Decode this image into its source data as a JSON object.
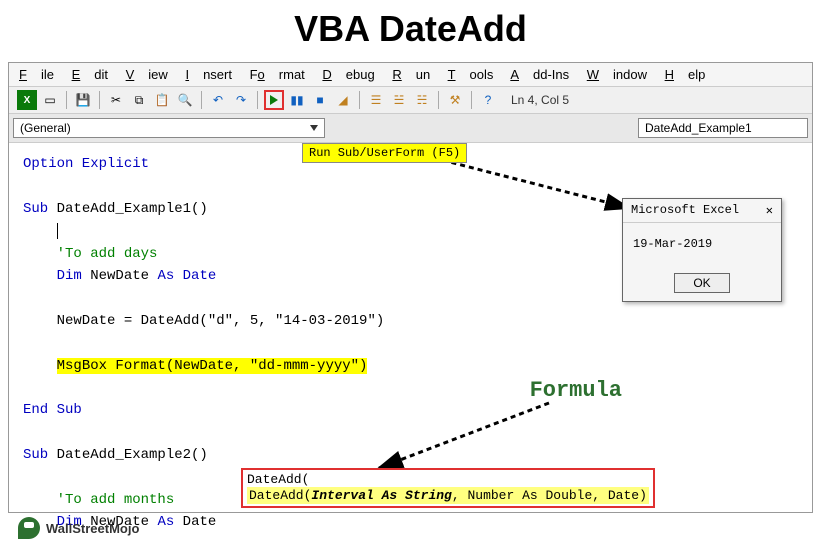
{
  "title": "VBA DateAdd",
  "menubar": [
    "File",
    "Edit",
    "View",
    "Insert",
    "Format",
    "Debug",
    "Run",
    "Tools",
    "Add-Ins",
    "Window",
    "Help"
  ],
  "status": "Ln 4, Col 5",
  "dropdowns": {
    "left": "(General)",
    "right": "DateAdd_Example1"
  },
  "callout_run": "Run Sub/UserForm (F5)",
  "code": {
    "l1": "Option Explicit",
    "l2": "Sub DateAdd_Example1()",
    "l3": "    'To add days",
    "l4": "    Dim NewDate As Date",
    "l5": "    NewDate = DateAdd(\"d\", 5, \"14-03-2019\")",
    "l6": "    MsgBox Format(NewDate, \"dd-mmm-yyyy\")",
    "l7": "End Sub",
    "l8": "Sub DateAdd_Example2()",
    "l9": "    'To add months",
    "l10": "    Dim NewDate As Date"
  },
  "msgbox": {
    "title": "Microsoft Excel",
    "body": "19-Mar-2019",
    "ok": "OK"
  },
  "formula_label": "Formula",
  "tooltip": {
    "typed": "DateAdd(",
    "sig_prefix": "DateAdd(",
    "sig_arg1": "Interval As String",
    "sig_rest": ", Number As Double, Date)"
  },
  "watermark": "WallStreetMojo",
  "colors": {
    "accent_red": "#e03030",
    "accent_green": "#2d7030",
    "highlight": "#ffff00"
  }
}
